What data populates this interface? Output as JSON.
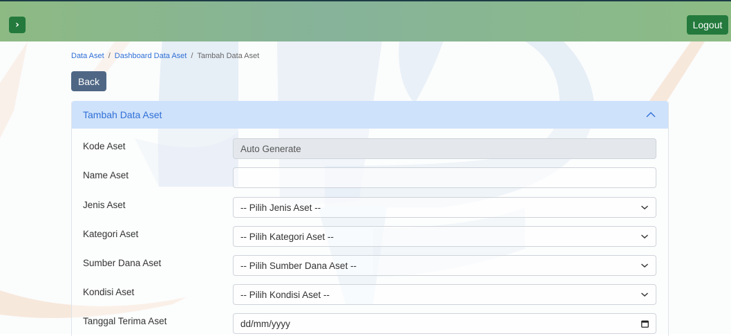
{
  "header": {
    "toggle_icon": "chevron-right-icon",
    "toggle_glyph": "›",
    "logout_label": "Logout"
  },
  "breadcrumb": {
    "item1": "Data Aset",
    "item2": "Dashboard Data Aset",
    "current": "Tambah Data Aset",
    "separator": "/"
  },
  "back_label": "Back",
  "card": {
    "title": "Tambah Data Aset",
    "collapse_icon": "chevron-up-icon"
  },
  "form": {
    "kode_label": "Kode Aset",
    "kode_value": "Auto Generate",
    "name_label": "Name Aset",
    "name_value": "",
    "jenis_label": "Jenis Aset",
    "jenis_value": "-- Pilih Jenis Aset --",
    "kategori_label": "Kategori Aset",
    "kategori_value": "-- Pilih Kategori Aset --",
    "sumber_label": "Sumber Dana Aset",
    "sumber_value": "-- Pilih Sumber Dana Aset --",
    "kondisi_label": "Kondisi Aset",
    "kondisi_value": "-- Pilih Kondisi Aset --",
    "tanggal_label": "Tanggal Terima Aset",
    "tanggal_placeholder": "dd/mm/yyyy"
  },
  "colors": {
    "header_green": "#8cbc84",
    "primary_green": "#237a3c",
    "link_blue": "#2f6fd6",
    "card_header_bg": "#cfe2fb",
    "back_button": "#4f6785",
    "watermark_blue": "#a9c4e6",
    "watermark_orange": "#f2b88e"
  }
}
